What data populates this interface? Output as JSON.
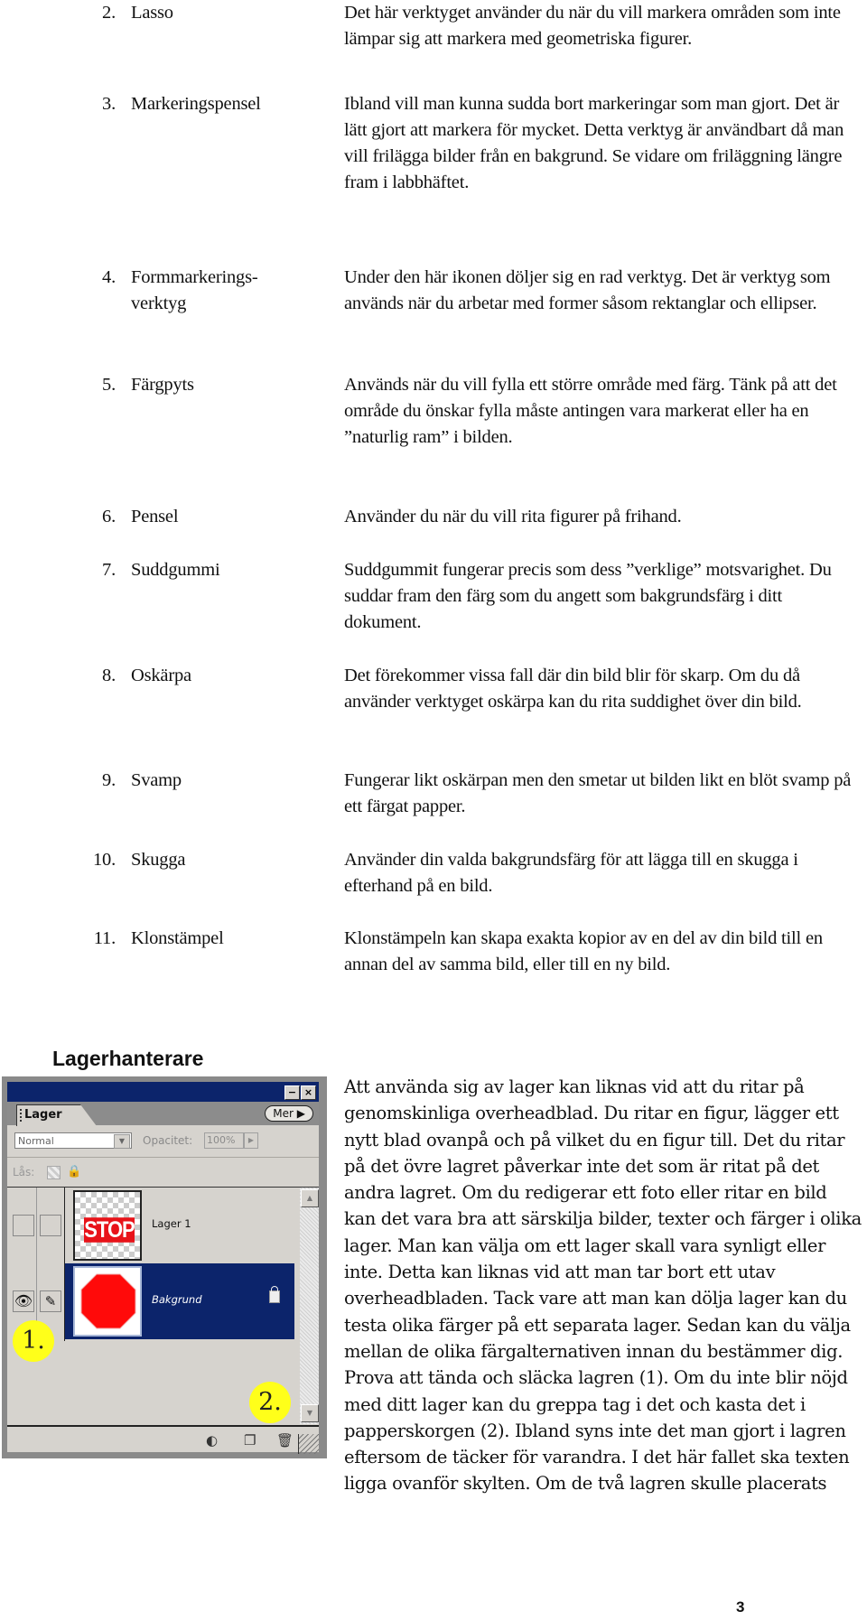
{
  "tools": [
    {
      "num": "2.",
      "name": "Lasso",
      "desc": "Det här verktyget använder du när du vill markera områden som inte lämpar sig att markera med geometriska figurer."
    },
    {
      "num": "3.",
      "name": "Markeringspensel",
      "desc": "Ibland vill man kunna sudda bort markeringar som man gjort. Det är lätt gjort att markera för mycket. Detta verktyg är användbart då man vill frilägga bilder från en bakgrund. Se vidare om friläggning längre fram i labbhäftet."
    },
    {
      "num": "4.",
      "name": "Formmarkerings- verktyg",
      "desc": "Under den här ikonen döljer sig en rad verktyg. Det är verktyg som används när du arbetar med former såsom rektanglar och ellipser."
    },
    {
      "num": "5.",
      "name": "Färgpyts",
      "desc": "Används när du vill fylla ett större område med färg. Tänk på att det område du önskar fylla måste antingen vara markerat eller ha en ”naturlig ram” i bilden."
    },
    {
      "num": "6.",
      "name": "Pensel",
      "desc": "Använder du när du vill rita figurer på frihand."
    },
    {
      "num": "7.",
      "name": "Suddgummi",
      "desc": "Suddgummit fungerar precis som dess ”verklige” motsvarighet. Du suddar fram den färg som du angett som bakgrundsfärg i ditt dokument."
    },
    {
      "num": "8.",
      "name": "Oskärpa",
      "desc": "Det förekommer vissa fall där din bild blir för skarp. Om du då använder verktyget oskärpa kan du rita suddighet över din bild."
    },
    {
      "num": "9.",
      "name": "Svamp",
      "desc": "Fungerar likt oskärpan men den smetar ut bilden likt en blöt svamp på ett färgat papper."
    },
    {
      "num": "10.",
      "name": "Skugga",
      "desc": "Använder din valda bakgrundsfärg för att lägga till en skugga i efterhand på en bild."
    },
    {
      "num": "11.",
      "name": "Klonstämpel",
      "desc": "Klonstämpeln kan skapa exakta kopior av en del av din bild till en annan del av samma bild, eller till en ny bild."
    }
  ],
  "section_title": "Lagerhanterare",
  "layers_panel": {
    "minimize_label": "−",
    "close_label": "×",
    "tab_label": "Lager",
    "more_button": "Mer ▶",
    "blend_mode": "Normal",
    "blend_arrow": "▼",
    "opacity_label": "Opacitet:",
    "opacity_value": "100%",
    "opacity_arrow": "▶",
    "lock_label": "Lås:",
    "lock_icon": "🔒",
    "layers": [
      {
        "name": "Lager 1",
        "thumb_text": "STOP",
        "visible": false,
        "selected": false
      },
      {
        "name": "Bakgrund",
        "visible": true,
        "selected": true,
        "locked": true
      }
    ],
    "eye_icon": "👁",
    "brush_icon": "✎",
    "scroll_up": "▲",
    "scroll_down": "▼",
    "bottom_icons": {
      "adjust": "◐",
      "new_layer": "❐",
      "trash": "🗑"
    },
    "colors": {
      "titlebar": "#0c246b",
      "selected_row": "#0c246b",
      "panel_bg": "#d6d3ce",
      "stop_red": "#e8131a"
    }
  },
  "callouts": [
    "1.",
    "2."
  ],
  "callout_color": "#ffff1a",
  "paragraph": "Att använda sig av lager kan liknas vid att du ritar på genomskinliga overheadblad. Du ritar en figur, lägger ett nytt blad ovanpå och på vilket du en figur till. Det du ritar på det övre lagret påverkar inte det som är ritat på det andra lagret. Om du redigerar ett foto eller ritar en bild kan det vara bra att särskilja bilder, texter och färger i olika lager. Man kan välja om ett lager skall vara synligt eller inte. Detta kan liknas vid att man tar bort ett utav overheadbladen. Tack vare att man kan dölja lager kan du testa olika färger på ett separata lager. Sedan kan du välja mellan de olika färgalternativen innan du bestämmer dig. Prova att tända och släcka lagren (1). Om du inte blir nöjd med ditt lager kan du greppa tag i det och kasta det i papperskorgen (2). Ibland syns inte det man gjort i lagren eftersom de täcker för varandra. I det här fallet ska texten ligga ovanför skylten. Om de två lagren skulle placerats",
  "page_number": "3"
}
